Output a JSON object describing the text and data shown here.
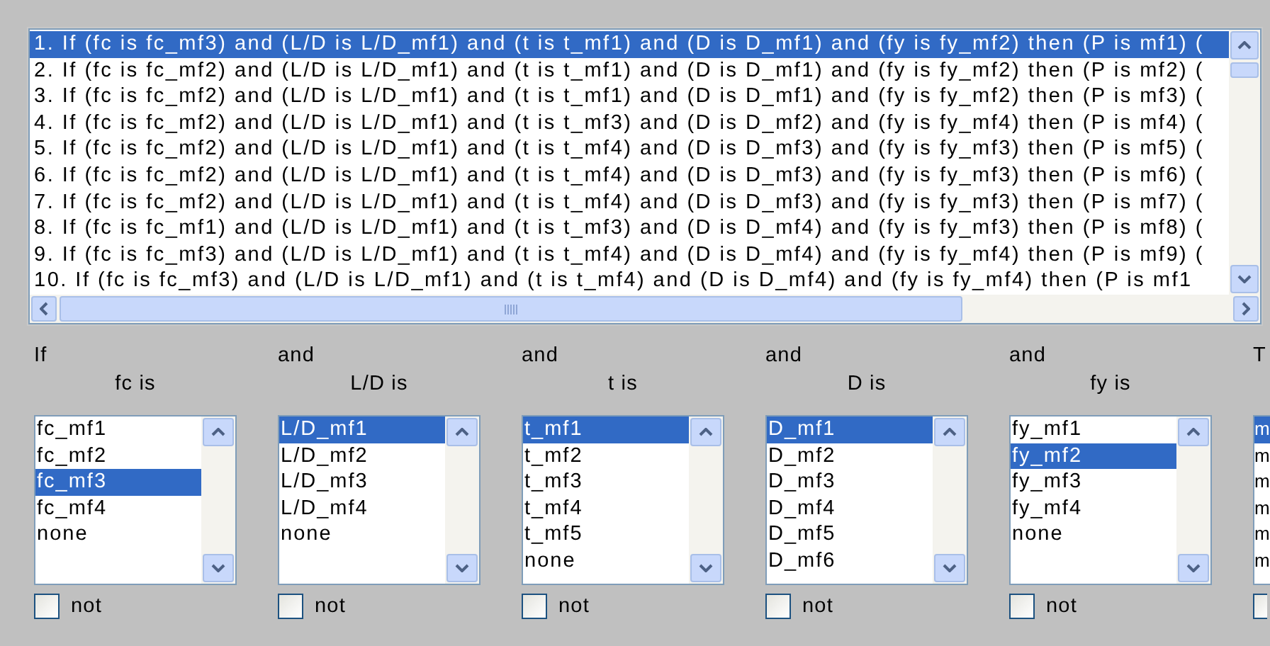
{
  "rules": {
    "items": [
      {
        "text": "1. If (fc is fc_mf3) and (L/D is L/D_mf1) and (t is t_mf1) and (D is D_mf1) and (fy is fy_mf2) then (P is mf1) (",
        "selected": true
      },
      {
        "text": "2. If (fc is fc_mf2) and (L/D is L/D_mf1) and (t is t_mf1) and (D is D_mf1) and (fy is fy_mf2) then (P is mf2) (",
        "selected": false
      },
      {
        "text": "3. If (fc is fc_mf2) and (L/D is L/D_mf1) and (t is t_mf1) and (D is D_mf1) and (fy is fy_mf2) then (P is mf3) (",
        "selected": false
      },
      {
        "text": "4. If (fc is fc_mf2) and (L/D is L/D_mf1) and (t is t_mf3) and (D is D_mf2) and (fy is fy_mf4) then (P is mf4) (",
        "selected": false
      },
      {
        "text": "5. If (fc is fc_mf2) and (L/D is L/D_mf1) and (t is t_mf4) and (D is D_mf3) and (fy is fy_mf3) then (P is mf5) (",
        "selected": false
      },
      {
        "text": "6. If (fc is fc_mf2) and (L/D is L/D_mf1) and (t is t_mf4) and (D is D_mf3) and (fy is fy_mf3) then (P is mf6) (",
        "selected": false
      },
      {
        "text": "7. If (fc is fc_mf2) and (L/D is L/D_mf1) and (t is t_mf4) and (D is D_mf3) and (fy is fy_mf3) then (P is mf7) (",
        "selected": false
      },
      {
        "text": "8. If (fc is fc_mf1) and (L/D is L/D_mf1) and (t is t_mf3) and (D is D_mf4) and (fy is fy_mf3) then (P is mf8) (",
        "selected": false
      },
      {
        "text": "9. If (fc is fc_mf3) and (L/D is L/D_mf1) and (t is t_mf4) and (D is D_mf4) and (fy is fy_mf4) then (P is mf9) (",
        "selected": false
      },
      {
        "text": "10. If (fc is fc_mf3) and (L/D is L/D_mf1) and (t is t_mf4) and (D is D_mf4) and (fy is fy_mf4) then (P is mf1",
        "selected": false
      }
    ]
  },
  "antecedents": [
    {
      "connective": "If",
      "heading": "fc is",
      "options": [
        {
          "label": "fc_mf1",
          "selected": false
        },
        {
          "label": "fc_mf2",
          "selected": false
        },
        {
          "label": "fc_mf3",
          "selected": true
        },
        {
          "label": "fc_mf4",
          "selected": false
        },
        {
          "label": "none",
          "selected": false
        }
      ],
      "not_label": "not",
      "not": false
    },
    {
      "connective": "and",
      "heading": "L/D is",
      "options": [
        {
          "label": "L/D_mf1",
          "selected": true
        },
        {
          "label": "L/D_mf2",
          "selected": false
        },
        {
          "label": "L/D_mf3",
          "selected": false
        },
        {
          "label": "L/D_mf4",
          "selected": false
        },
        {
          "label": "none",
          "selected": false
        }
      ],
      "not_label": "not",
      "not": false
    },
    {
      "connective": "and",
      "heading": "t is",
      "options": [
        {
          "label": "t_mf1",
          "selected": true
        },
        {
          "label": "t_mf2",
          "selected": false
        },
        {
          "label": "t_mf3",
          "selected": false
        },
        {
          "label": "t_mf4",
          "selected": false
        },
        {
          "label": "t_mf5",
          "selected": false
        },
        {
          "label": "none",
          "selected": false
        }
      ],
      "not_label": "not",
      "not": false
    },
    {
      "connective": "and",
      "heading": "D is",
      "options": [
        {
          "label": "D_mf1",
          "selected": true
        },
        {
          "label": "D_mf2",
          "selected": false
        },
        {
          "label": "D_mf3",
          "selected": false
        },
        {
          "label": "D_mf4",
          "selected": false
        },
        {
          "label": "D_mf5",
          "selected": false
        },
        {
          "label": "D_mf6",
          "selected": false
        }
      ],
      "not_label": "not",
      "not": false
    },
    {
      "connective": "and",
      "heading": "fy is",
      "options": [
        {
          "label": "fy_mf1",
          "selected": false
        },
        {
          "label": "fy_mf2",
          "selected": true
        },
        {
          "label": "fy_mf3",
          "selected": false
        },
        {
          "label": "fy_mf4",
          "selected": false
        },
        {
          "label": "none",
          "selected": false
        }
      ],
      "not_label": "not",
      "not": false
    }
  ],
  "consequent": {
    "connective": "T",
    "options": [
      {
        "label": "m",
        "selected": true
      },
      {
        "label": "m",
        "selected": false
      },
      {
        "label": "m",
        "selected": false
      },
      {
        "label": "m",
        "selected": false
      },
      {
        "label": "m",
        "selected": false
      },
      {
        "label": "m",
        "selected": false
      }
    ],
    "not": false
  }
}
